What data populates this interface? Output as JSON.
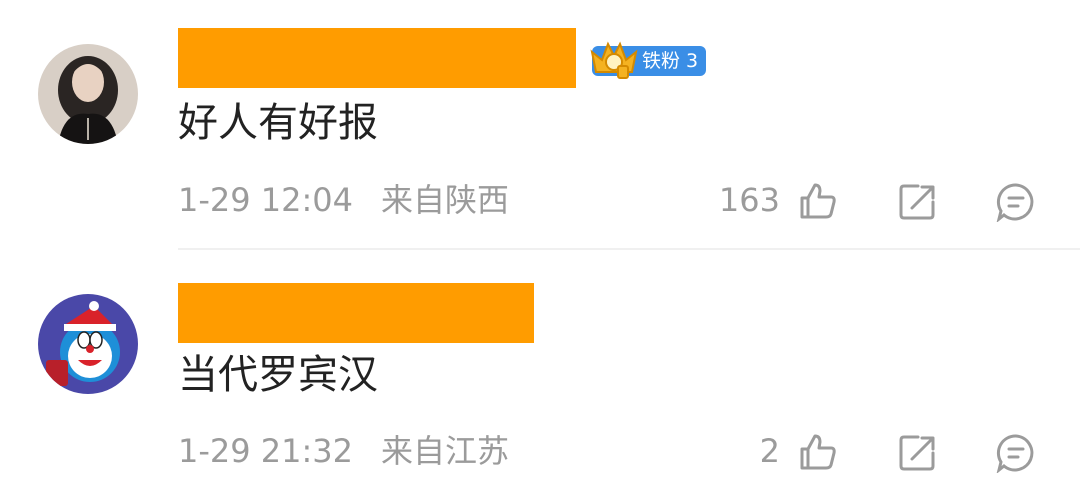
{
  "colors": {
    "name_redaction": "#ff9c00",
    "badge_bg": "#3a8ee6",
    "meta_text": "#9b9b9b",
    "body_text": "#222222"
  },
  "comments": [
    {
      "avatar": "woman-portrait-avatar",
      "badge": "铁粉 3",
      "text": "好人有好报",
      "time": "1-29 12:04",
      "location": "来自陕西",
      "likes": "163"
    },
    {
      "avatar": "doraemon-avatar",
      "text": "当代罗宾汉",
      "time": "1-29 21:32",
      "location": "来自江苏",
      "likes": "2"
    }
  ],
  "icons": {
    "like": "thumbs-up-icon",
    "share": "share-icon",
    "reply": "comment-icon"
  }
}
